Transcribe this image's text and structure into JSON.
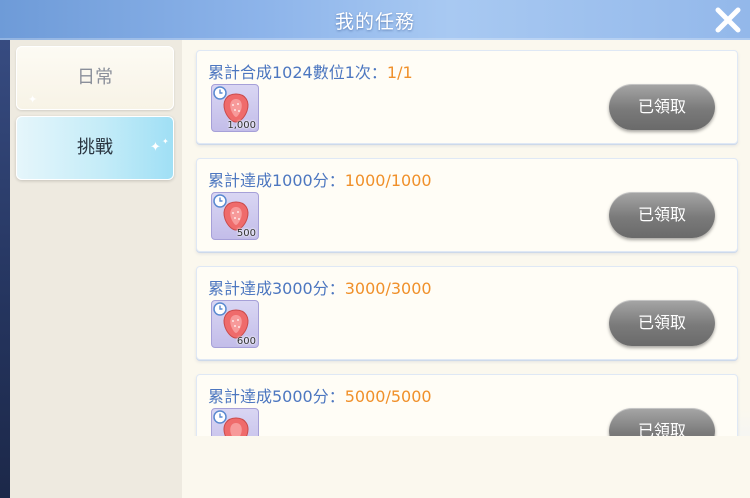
{
  "header": {
    "title": "我的任務"
  },
  "tabs": [
    {
      "label": "日常",
      "active": false
    },
    {
      "label": "挑戰",
      "active": true
    }
  ],
  "tasks": [
    {
      "title": "累計合成1024數位1次：",
      "progress": "1/1",
      "reward_count": "1,000",
      "button": "已領取"
    },
    {
      "title": "累計達成1000分：",
      "progress": "1000/1000",
      "reward_count": "500",
      "button": "已領取"
    },
    {
      "title": "累計達成3000分：",
      "progress": "3000/3000",
      "reward_count": "600",
      "button": "已領取"
    },
    {
      "title": "累計達成5000分：",
      "progress": "5000/5000",
      "reward_count": "",
      "button": "已領取"
    }
  ],
  "colors": {
    "title_blue": "#4d77c0",
    "progress_orange": "#f0902a",
    "active_tab": "#9fdff5"
  },
  "icons": {
    "close": "close-x-icon",
    "reward": "strawberry-icon"
  }
}
